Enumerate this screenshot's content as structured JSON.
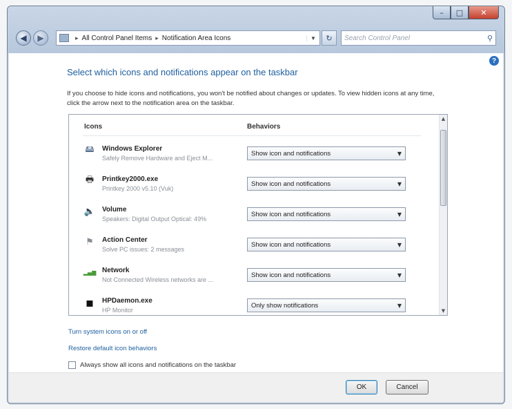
{
  "window": {
    "caption_min": "–",
    "caption_max": "□",
    "caption_close": "✕"
  },
  "nav": {
    "back_glyph": "◀",
    "forward_glyph": "▶",
    "breadcrumb": [
      "All Control Panel Items",
      "Notification Area Icons"
    ],
    "crumb_separator": "▸",
    "dropdown_glyph": "▼",
    "refresh_glyph": "↻",
    "search_placeholder": "Search Control Panel",
    "search_glyph": "⚲"
  },
  "page": {
    "title": "Select which icons and notifications appear on the taskbar",
    "description": "If you choose to hide icons and notifications, you won't be notified about changes or updates. To view hidden icons at any time, click the arrow next to the notification area on the taskbar.",
    "help_glyph": "?"
  },
  "table": {
    "headers": {
      "icons": "Icons",
      "behaviors": "Behaviors"
    },
    "rows": [
      {
        "icon": "windows-explorer-icon",
        "glyph": "🖴",
        "name": "Windows Explorer",
        "desc": "Safely Remove Hardware and Eject M...",
        "behavior": "Show icon and notifications"
      },
      {
        "icon": "printkey-icon",
        "glyph": "🖶",
        "name": "Printkey2000.exe",
        "desc": "Printkey 2000 v5.10 (Vuk)",
        "behavior": "Show icon and notifications"
      },
      {
        "icon": "volume-icon",
        "glyph": "🔈",
        "name": "Volume",
        "desc": "Speakers: Digital Output Optical: 49%",
        "behavior": "Show icon and notifications"
      },
      {
        "icon": "action-center-icon",
        "glyph": "⚑",
        "name": "Action Center",
        "desc": "Solve PC issues: 2 messages",
        "behavior": "Show icon and notifications"
      },
      {
        "icon": "network-icon",
        "glyph": "▂▄▆",
        "name": "Network",
        "desc": "Not Connected  Wireless networks are ...",
        "behavior": "Show icon and notifications"
      },
      {
        "icon": "hp-monitor-icon",
        "glyph": "▪",
        "name": "HPDaemon.exe",
        "desc": "HP Monitor",
        "behavior": "Only show notifications"
      }
    ],
    "select_arrow": "▼",
    "scroll_up": "▲",
    "scroll_down": "▼"
  },
  "links": {
    "system_icons": "Turn system icons on or off",
    "restore": "Restore default icon behaviors"
  },
  "checkbox": {
    "label": "Always show all icons and notifications on the taskbar",
    "checked": false
  },
  "footer": {
    "ok": "OK",
    "cancel": "Cancel"
  },
  "colors": {
    "link": "#1e5e9e",
    "title": "#1e5e9e",
    "frame": "#cfd9e6",
    "close_button": "#c4402c"
  }
}
